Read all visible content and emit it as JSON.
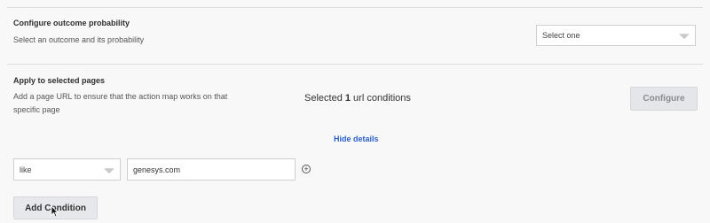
{
  "outcome": {
    "title": "Configure outcome probability",
    "description": "Select an outcome and its probability",
    "select_value": "Select one"
  },
  "pages": {
    "title": "Apply to selected pages",
    "description": "Add a page URL to ensure that the action map works on that specific page",
    "selected_prefix": "Selected ",
    "selected_count": "1",
    "selected_suffix": " url conditions",
    "configure_label": "Configure",
    "hide_details_label": "Hide details"
  },
  "condition": {
    "operator": "like",
    "value": "genesys.com",
    "add_label": "Add Condition"
  },
  "icons": {
    "add_row": "plus-circle-icon",
    "caret": "chevron-down-icon",
    "cursor": "pointer-cursor-icon"
  },
  "colors": {
    "link": "#2a60c8",
    "button_bg": "#e4e6ea"
  }
}
